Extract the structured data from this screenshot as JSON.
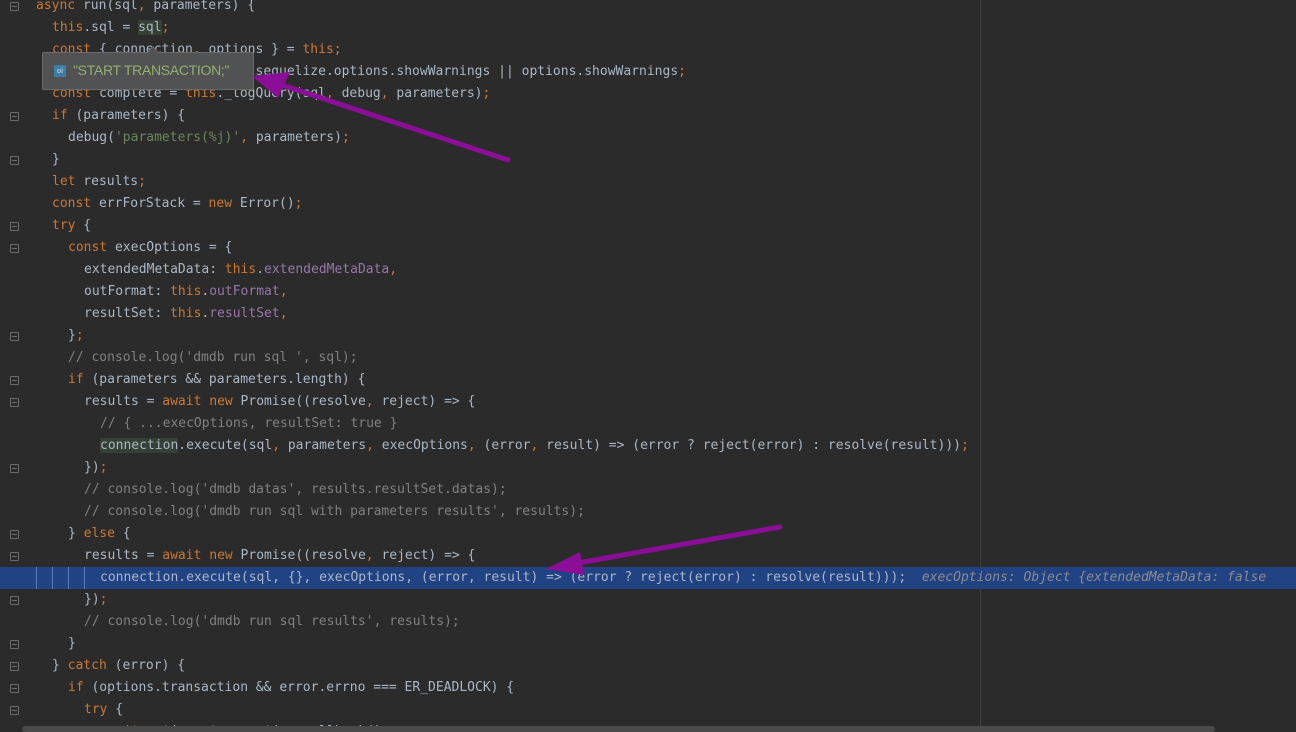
{
  "colors": {
    "background": "#2b2b2b",
    "keyword": "#cc7832",
    "string": "#6a8759",
    "comment": "#808080",
    "property": "#9876aa",
    "selection": "#214283",
    "annotation_arrow": "#8a0f96"
  },
  "tooltip": {
    "icon": "variable-o-icon",
    "icon_text": "oi",
    "value": "\"START TRANSACTION;\""
  },
  "code_lines": [
    "async run(sql, parameters) {",
    "this.sql = sql;",
    "const { connection, options } = this;",
    "const showWarnings = this.sequelize.options.showWarnings || options.showWarnings;",
    "const complete = this._logQuery(sql, debug, parameters);",
    "if (parameters) {",
    "debug('parameters(%j)', parameters);",
    "}",
    "let results;",
    "const errForStack = new Error();",
    "try {",
    "const execOptions = {",
    "extendedMetaData: this.extendedMetaData,",
    "outFormat: this.outFormat,",
    "resultSet: this.resultSet,",
    "};",
    "// console.log('dmdb run sql ', sql);",
    "if (parameters && parameters.length) {",
    "results = await new Promise((resolve, reject) => {",
    "// { ...execOptions, resultSet: true }",
    "connection.execute(sql, parameters, execOptions, (error, result) => (error ? reject(error) : resolve(result)));",
    "});",
    "// console.log('dmdb datas', results.resultSet.datas);",
    "// console.log('dmdb run sql with parameters results', results);",
    "} else {",
    "results = await new Promise((resolve, reject) => {",
    "connection.execute(sql, {}, execOptions, (error, result) => (error ? reject(error) : resolve(result)));",
    "});",
    "// console.log('dmdb run sql results', results);",
    "}",
    "} catch (error) {",
    "if (options.transaction && error.errno === ER_DEADLOCK) {",
    "try {",
    "await options.transaction.rollback();"
  ],
  "inline_hint": "execOptions: Object {extendedMetaData: false"
}
